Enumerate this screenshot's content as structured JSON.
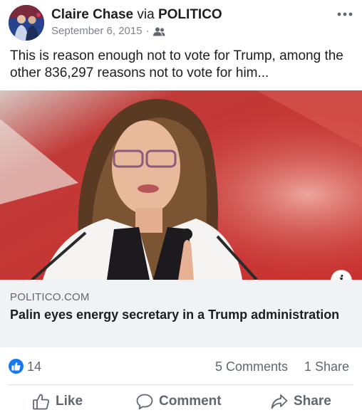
{
  "post": {
    "author": "Claire Chase",
    "via": "via",
    "page": "POLITICO",
    "date": "September 6, 2015",
    "separator": "·",
    "audience_icon": "friends-icon",
    "text": "This is reason enough not to vote for Trump, among the other 836,297 reasons not to vote for him..."
  },
  "link": {
    "domain": "POLITICO.COM",
    "title": "Palin eyes energy secretary in a Trump administration",
    "info_label": "i"
  },
  "engagement": {
    "likes": "14",
    "comments": "5 Comments",
    "shares": "1 Share"
  },
  "actions": {
    "like": "Like",
    "comment": "Comment",
    "share": "Share"
  },
  "colors": {
    "accent": "#1877f2",
    "secondary_text": "#606770",
    "link_box_bg": "#f0f2f5"
  }
}
